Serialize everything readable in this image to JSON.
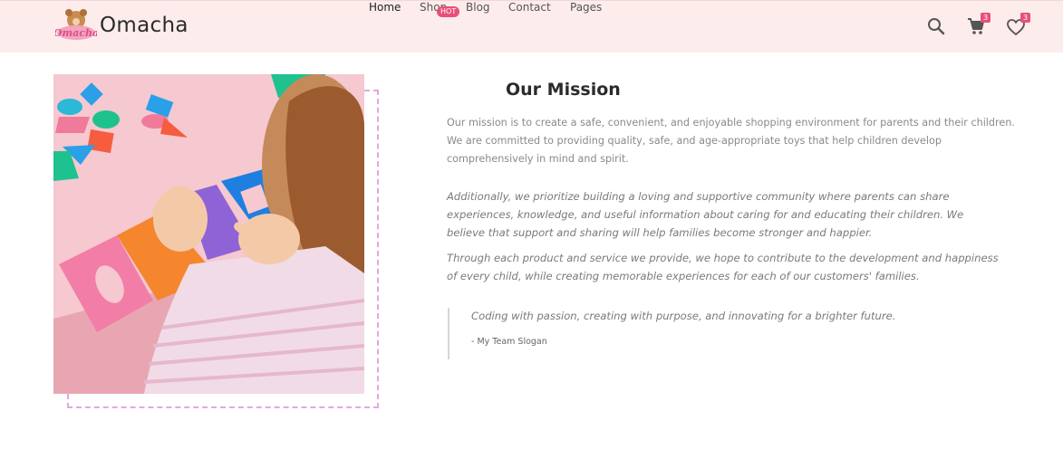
{
  "header": {
    "brand": "Omacha",
    "logo_text": "Omacha",
    "nav": [
      {
        "label": "Home"
      },
      {
        "label": "Shop",
        "badge": "HOT"
      },
      {
        "label": "Blog"
      },
      {
        "label": "Contact"
      },
      {
        "label": "Pages"
      }
    ],
    "icons": {
      "search": "search-icon",
      "cart": "cart-icon",
      "wishlist": "heart-icon"
    },
    "cart_count": "3",
    "wishlist_count": "3"
  },
  "mission": {
    "title": "Our Mission",
    "paragraph1": "Our mission is to create a safe, convenient, and enjoyable shopping environment for parents and their children. We are committed to providing quality, safe, and age-appropriate toys that help children develop comprehensively in mind and spirit.",
    "paragraph2": "Additionally, we prioritize building a loving and supportive community where parents can share experiences, knowledge, and useful information about caring for and educating their children. We believe that support and sharing will help families become stronger and happier.",
    "paragraph3": "Through each product and service we provide, we hope to contribute to the development and happiness of every child, while creating memorable experiences for each of our customers' families.",
    "quote": "Coding with passion, creating with purpose, and innovating for a brighter future.",
    "quote_author": "- My Team Slogan"
  },
  "colors": {
    "header_bg": "#fdecec",
    "accent": "#e8507a",
    "dashed_frame": "#e3a8e0"
  }
}
